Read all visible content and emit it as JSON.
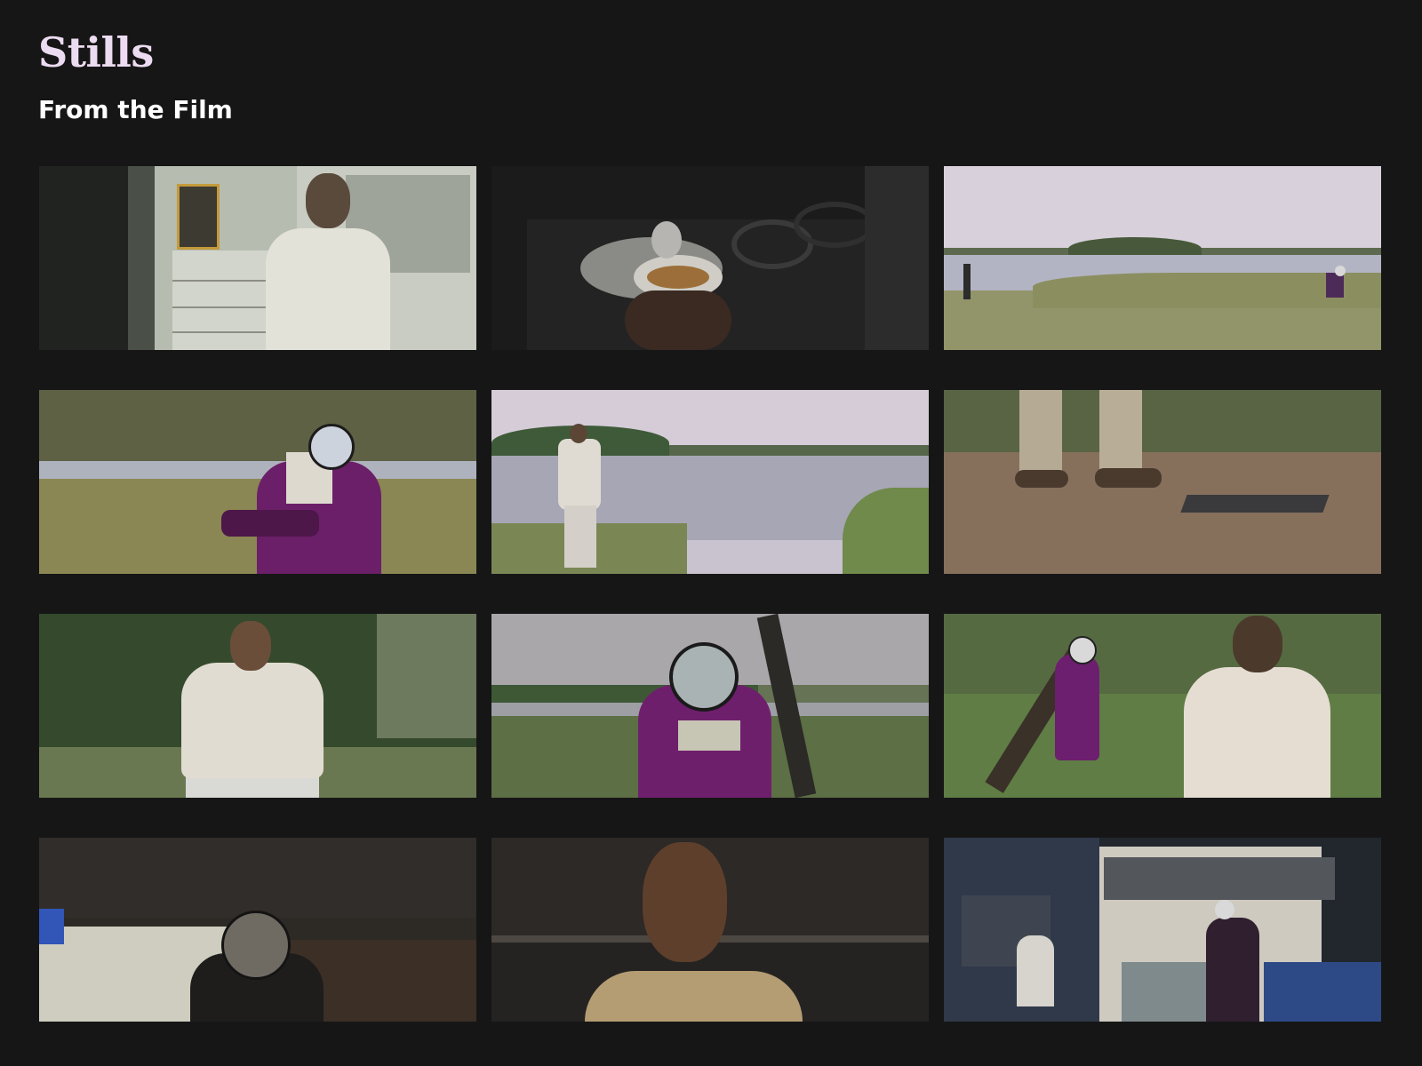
{
  "header": {
    "title": "Stills",
    "subtitle": "From the Film"
  },
  "gallery": {
    "stills": [
      {
        "label": ""
      },
      {
        "label": ""
      },
      {
        "label": ""
      },
      {
        "label": ""
      },
      {
        "label": ""
      },
      {
        "label": ""
      },
      {
        "label": ""
      },
      {
        "label": ""
      },
      {
        "label": ""
      },
      {
        "label": ""
      },
      {
        "label": ""
      },
      {
        "label": ""
      }
    ]
  },
  "colors": {
    "background": "#161616",
    "title": "#ecdcf1",
    "subtitle": "#ffffff",
    "robe_purple": "#6e1f6c"
  }
}
